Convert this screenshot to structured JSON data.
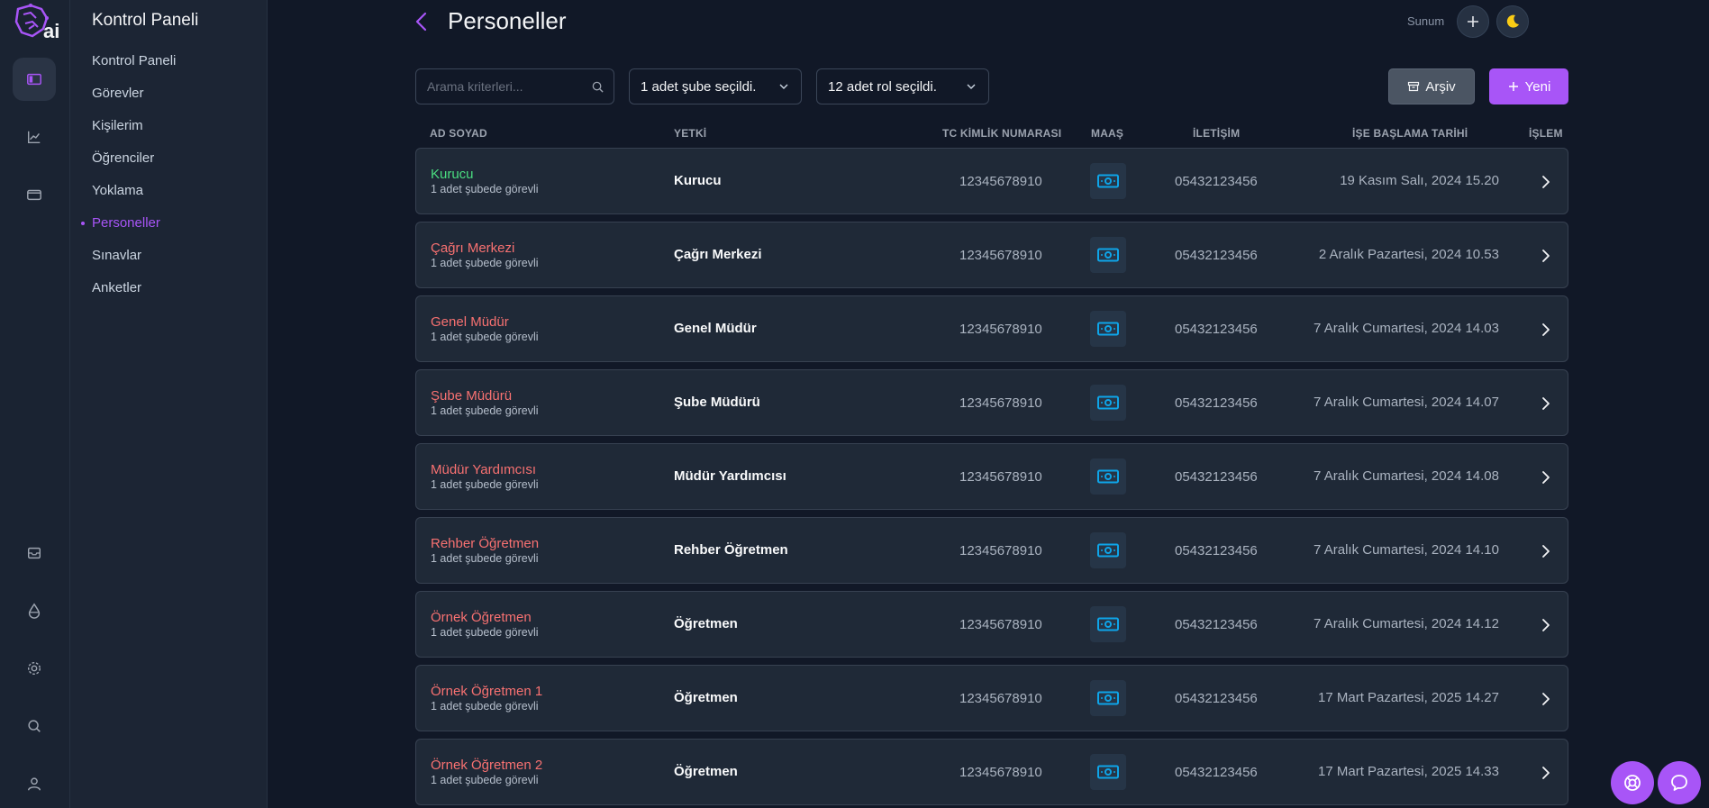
{
  "logo": {
    "text": "ai"
  },
  "rail": {
    "items": [
      {
        "icon": "sidebar-toggle-icon"
      },
      {
        "icon": "chart-icon"
      },
      {
        "icon": "wallet-icon"
      },
      {
        "icon": "inbox-icon"
      },
      {
        "icon": "drop-icon"
      },
      {
        "icon": "gear-icon"
      },
      {
        "icon": "search-icon"
      },
      {
        "icon": "user-icon"
      }
    ]
  },
  "menu": {
    "title": "Kontrol Paneli",
    "items": [
      {
        "label": "Kontrol Paneli"
      },
      {
        "label": "Görevler"
      },
      {
        "label": "Kişilerim"
      },
      {
        "label": "Öğrenciler"
      },
      {
        "label": "Yoklama"
      },
      {
        "label": "Personeller",
        "active": true
      },
      {
        "label": "Sınavlar"
      },
      {
        "label": "Anketler"
      }
    ]
  },
  "header": {
    "title": "Personeller",
    "sunum_label": "Sunum"
  },
  "toolbar": {
    "search_placeholder": "Arama kriterleri...",
    "branch_select": "1 adet şube seçildi.",
    "role_select": "12 adet rol seçildi.",
    "archive_label": "Arşiv",
    "new_label": "Yeni"
  },
  "table": {
    "columns": {
      "name": "AD SOYAD",
      "role": "YETKİ",
      "tc": "TC KİMLİK NUMARASI",
      "salary": "MAAŞ",
      "contact": "İLETİŞİM",
      "start": "İŞE BAŞLAMA TARİHİ",
      "action": "İŞLEM"
    },
    "rows": [
      {
        "name": "Kurucu",
        "sub": "1 adet şubede görevli",
        "role": "Kurucu",
        "tc": "12345678910",
        "phone": "05432123456",
        "date": "19 Kasım Salı, 2024 15.20"
      },
      {
        "name": "Çağrı Merkezi",
        "sub": "1 adet şubede görevli",
        "role": "Çağrı Merkezi",
        "tc": "12345678910",
        "phone": "05432123456",
        "date": "2 Aralık Pazartesi, 2024 10.53"
      },
      {
        "name": "Genel Müdür",
        "sub": "1 adet şubede görevli",
        "role": "Genel Müdür",
        "tc": "12345678910",
        "phone": "05432123456",
        "date": "7 Aralık Cumartesi, 2024 14.03"
      },
      {
        "name": "Şube Müdürü",
        "sub": "1 adet şubede görevli",
        "role": "Şube Müdürü",
        "tc": "12345678910",
        "phone": "05432123456",
        "date": "7 Aralık Cumartesi, 2024 14.07"
      },
      {
        "name": "Müdür Yardımcısı",
        "sub": "1 adet şubede görevli",
        "role": "Müdür Yardımcısı",
        "tc": "12345678910",
        "phone": "05432123456",
        "date": "7 Aralık Cumartesi, 2024 14.08"
      },
      {
        "name": "Rehber Öğretmen",
        "sub": "1 adet şubede görevli",
        "role": "Rehber Öğretmen",
        "tc": "12345678910",
        "phone": "05432123456",
        "date": "7 Aralık Cumartesi, 2024 14.10"
      },
      {
        "name": "Örnek Öğretmen",
        "sub": "1 adet şubede görevli",
        "role": "Öğretmen",
        "tc": "12345678910",
        "phone": "05432123456",
        "date": "7 Aralık Cumartesi, 2024 14.12"
      },
      {
        "name": "Örnek Öğretmen 1",
        "sub": "1 adet şubede görevli",
        "role": "Öğretmen",
        "tc": "12345678910",
        "phone": "05432123456",
        "date": "17 Mart Pazartesi, 2025 14.27"
      },
      {
        "name": "Örnek Öğretmen 2",
        "sub": "1 adet şubede görevli",
        "role": "Öğretmen",
        "tc": "12345678910",
        "phone": "05432123456",
        "date": "17 Mart Pazartesi, 2025 14.33"
      }
    ]
  },
  "colors": {
    "accent": "#a855f7",
    "founder_name": "#4ade80",
    "staff_name": "#f87171",
    "salary_icon": "#0ea5e9"
  }
}
